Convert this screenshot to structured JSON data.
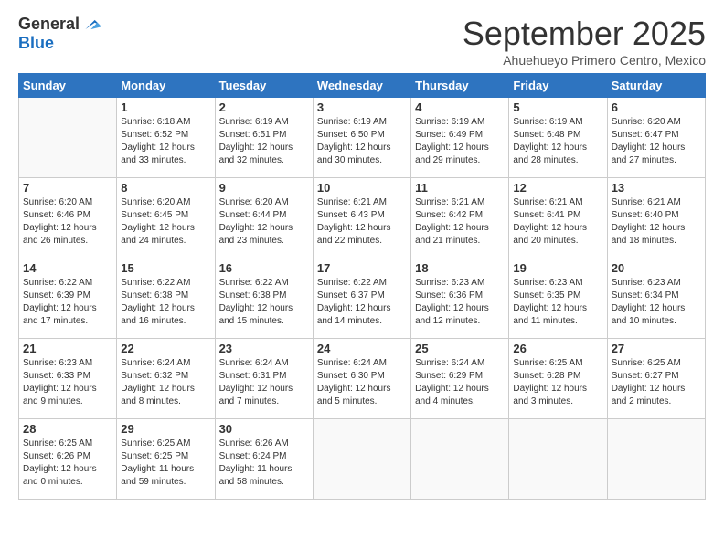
{
  "logo": {
    "line1": "General",
    "line2": "Blue"
  },
  "header": {
    "month": "September 2025",
    "location": "Ahuehueyo Primero Centro, Mexico"
  },
  "weekdays": [
    "Sunday",
    "Monday",
    "Tuesday",
    "Wednesday",
    "Thursday",
    "Friday",
    "Saturday"
  ],
  "weeks": [
    [
      {
        "day": "",
        "info": ""
      },
      {
        "day": "1",
        "info": "Sunrise: 6:18 AM\nSunset: 6:52 PM\nDaylight: 12 hours\nand 33 minutes."
      },
      {
        "day": "2",
        "info": "Sunrise: 6:19 AM\nSunset: 6:51 PM\nDaylight: 12 hours\nand 32 minutes."
      },
      {
        "day": "3",
        "info": "Sunrise: 6:19 AM\nSunset: 6:50 PM\nDaylight: 12 hours\nand 30 minutes."
      },
      {
        "day": "4",
        "info": "Sunrise: 6:19 AM\nSunset: 6:49 PM\nDaylight: 12 hours\nand 29 minutes."
      },
      {
        "day": "5",
        "info": "Sunrise: 6:19 AM\nSunset: 6:48 PM\nDaylight: 12 hours\nand 28 minutes."
      },
      {
        "day": "6",
        "info": "Sunrise: 6:20 AM\nSunset: 6:47 PM\nDaylight: 12 hours\nand 27 minutes."
      }
    ],
    [
      {
        "day": "7",
        "info": "Sunrise: 6:20 AM\nSunset: 6:46 PM\nDaylight: 12 hours\nand 26 minutes."
      },
      {
        "day": "8",
        "info": "Sunrise: 6:20 AM\nSunset: 6:45 PM\nDaylight: 12 hours\nand 24 minutes."
      },
      {
        "day": "9",
        "info": "Sunrise: 6:20 AM\nSunset: 6:44 PM\nDaylight: 12 hours\nand 23 minutes."
      },
      {
        "day": "10",
        "info": "Sunrise: 6:21 AM\nSunset: 6:43 PM\nDaylight: 12 hours\nand 22 minutes."
      },
      {
        "day": "11",
        "info": "Sunrise: 6:21 AM\nSunset: 6:42 PM\nDaylight: 12 hours\nand 21 minutes."
      },
      {
        "day": "12",
        "info": "Sunrise: 6:21 AM\nSunset: 6:41 PM\nDaylight: 12 hours\nand 20 minutes."
      },
      {
        "day": "13",
        "info": "Sunrise: 6:21 AM\nSunset: 6:40 PM\nDaylight: 12 hours\nand 18 minutes."
      }
    ],
    [
      {
        "day": "14",
        "info": "Sunrise: 6:22 AM\nSunset: 6:39 PM\nDaylight: 12 hours\nand 17 minutes."
      },
      {
        "day": "15",
        "info": "Sunrise: 6:22 AM\nSunset: 6:38 PM\nDaylight: 12 hours\nand 16 minutes."
      },
      {
        "day": "16",
        "info": "Sunrise: 6:22 AM\nSunset: 6:38 PM\nDaylight: 12 hours\nand 15 minutes."
      },
      {
        "day": "17",
        "info": "Sunrise: 6:22 AM\nSunset: 6:37 PM\nDaylight: 12 hours\nand 14 minutes."
      },
      {
        "day": "18",
        "info": "Sunrise: 6:23 AM\nSunset: 6:36 PM\nDaylight: 12 hours\nand 12 minutes."
      },
      {
        "day": "19",
        "info": "Sunrise: 6:23 AM\nSunset: 6:35 PM\nDaylight: 12 hours\nand 11 minutes."
      },
      {
        "day": "20",
        "info": "Sunrise: 6:23 AM\nSunset: 6:34 PM\nDaylight: 12 hours\nand 10 minutes."
      }
    ],
    [
      {
        "day": "21",
        "info": "Sunrise: 6:23 AM\nSunset: 6:33 PM\nDaylight: 12 hours\nand 9 minutes."
      },
      {
        "day": "22",
        "info": "Sunrise: 6:24 AM\nSunset: 6:32 PM\nDaylight: 12 hours\nand 8 minutes."
      },
      {
        "day": "23",
        "info": "Sunrise: 6:24 AM\nSunset: 6:31 PM\nDaylight: 12 hours\nand 7 minutes."
      },
      {
        "day": "24",
        "info": "Sunrise: 6:24 AM\nSunset: 6:30 PM\nDaylight: 12 hours\nand 5 minutes."
      },
      {
        "day": "25",
        "info": "Sunrise: 6:24 AM\nSunset: 6:29 PM\nDaylight: 12 hours\nand 4 minutes."
      },
      {
        "day": "26",
        "info": "Sunrise: 6:25 AM\nSunset: 6:28 PM\nDaylight: 12 hours\nand 3 minutes."
      },
      {
        "day": "27",
        "info": "Sunrise: 6:25 AM\nSunset: 6:27 PM\nDaylight: 12 hours\nand 2 minutes."
      }
    ],
    [
      {
        "day": "28",
        "info": "Sunrise: 6:25 AM\nSunset: 6:26 PM\nDaylight: 12 hours\nand 0 minutes."
      },
      {
        "day": "29",
        "info": "Sunrise: 6:25 AM\nSunset: 6:25 PM\nDaylight: 11 hours\nand 59 minutes."
      },
      {
        "day": "30",
        "info": "Sunrise: 6:26 AM\nSunset: 6:24 PM\nDaylight: 11 hours\nand 58 minutes."
      },
      {
        "day": "",
        "info": ""
      },
      {
        "day": "",
        "info": ""
      },
      {
        "day": "",
        "info": ""
      },
      {
        "day": "",
        "info": ""
      }
    ]
  ]
}
